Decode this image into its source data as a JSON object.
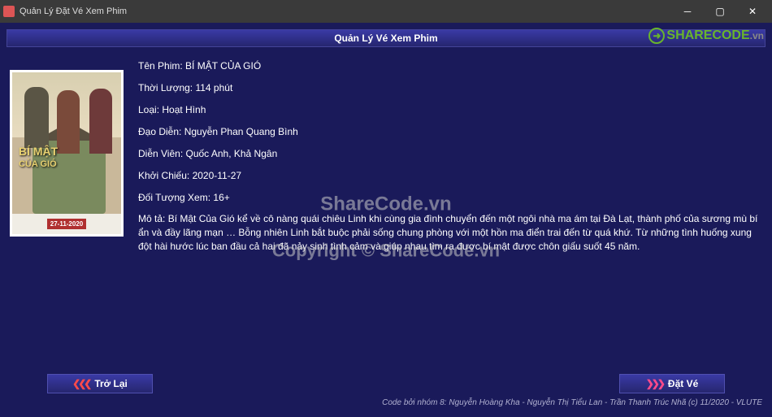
{
  "window": {
    "title": "Quản Lý Đặt Vé Xem Phim"
  },
  "header": {
    "title": "Quản Lý Vé Xem Phim"
  },
  "movie": {
    "name_label": "Tên Phim",
    "name": "BÍ MẬT CỦA GIÓ",
    "duration_label": "Thời Lượng",
    "duration": "114 phút",
    "genre_label": "Loại",
    "genre": "Hoạt Hình",
    "director_label": "Đạo Diễn",
    "director": "Nguyễn Phan Quang Bình",
    "cast_label": "Diễn Viên",
    "cast": "Quốc Anh, Khả Ngân",
    "release_label": "Khởi Chiếu",
    "release": "2020-11-27",
    "rating_label": "Đối Tượng Xem",
    "rating": "16+",
    "desc_label": "Mô tả",
    "desc": "Bí Mật Của Gió kể về cô nàng quái chiêu Linh khi cùng gia đình chuyển đến một ngôi nhà ma ám tại Đà Lạt, thành phố của sương mù bí ẩn và đầy lãng mạn … Bỗng nhiên Linh bắt buộc phải sống chung phòng với một hồn ma điển trai đến từ quá khứ. Từ những tình huống xung đột hài hước lúc ban đầu cả hai đã nảy sinh tình cảm và giúp nhau tìm ra được bí mật được chôn giấu suốt 45 năm."
  },
  "poster": {
    "title_line1": "BÍ MẬT",
    "title_line2": "CỦA GIÓ",
    "date_badge": "27-11-2020"
  },
  "buttons": {
    "back": "Trở Lại",
    "book": "Đặt Vé"
  },
  "footer": {
    "credit": "Code bởi nhóm 8: Nguyễn Hoàng Kha - Nguyễn Thị Tiểu Lan - Trần Thanh Trúc Nhã (c) 11/2020 - VLUTE"
  },
  "watermarks": {
    "sharecode_brand": "SHARECODE",
    "sharecode_tld": ".vn",
    "center_line1": "ShareCode.vn",
    "center_line2": "Copyright © ShareCode.vn"
  }
}
